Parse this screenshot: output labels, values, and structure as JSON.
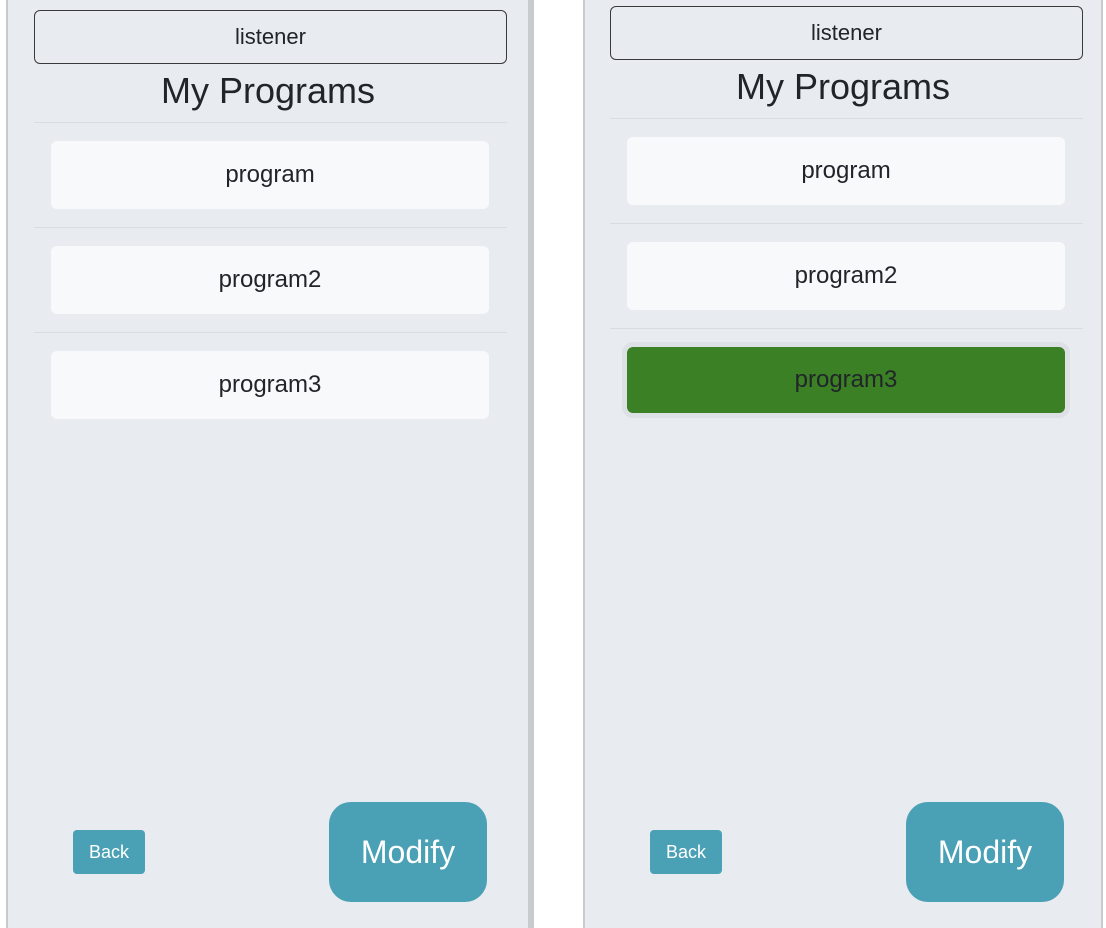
{
  "screens": [
    {
      "listener_label": "listener",
      "title": "My Programs",
      "programs": [
        {
          "label": "program",
          "selected": false
        },
        {
          "label": "program2",
          "selected": false
        },
        {
          "label": "program3",
          "selected": false
        }
      ],
      "back_label": "Back",
      "modify_label": "Modify"
    },
    {
      "listener_label": "listener",
      "title": "My Programs",
      "programs": [
        {
          "label": "program",
          "selected": false
        },
        {
          "label": "program2",
          "selected": false
        },
        {
          "label": "program3",
          "selected": true
        }
      ],
      "back_label": "Back",
      "modify_label": "Modify"
    }
  ],
  "colors": {
    "background": "#e8ebf0",
    "item_background": "#f8f9fb",
    "selected": "#3b8025",
    "accent": "#4aa0b5"
  }
}
